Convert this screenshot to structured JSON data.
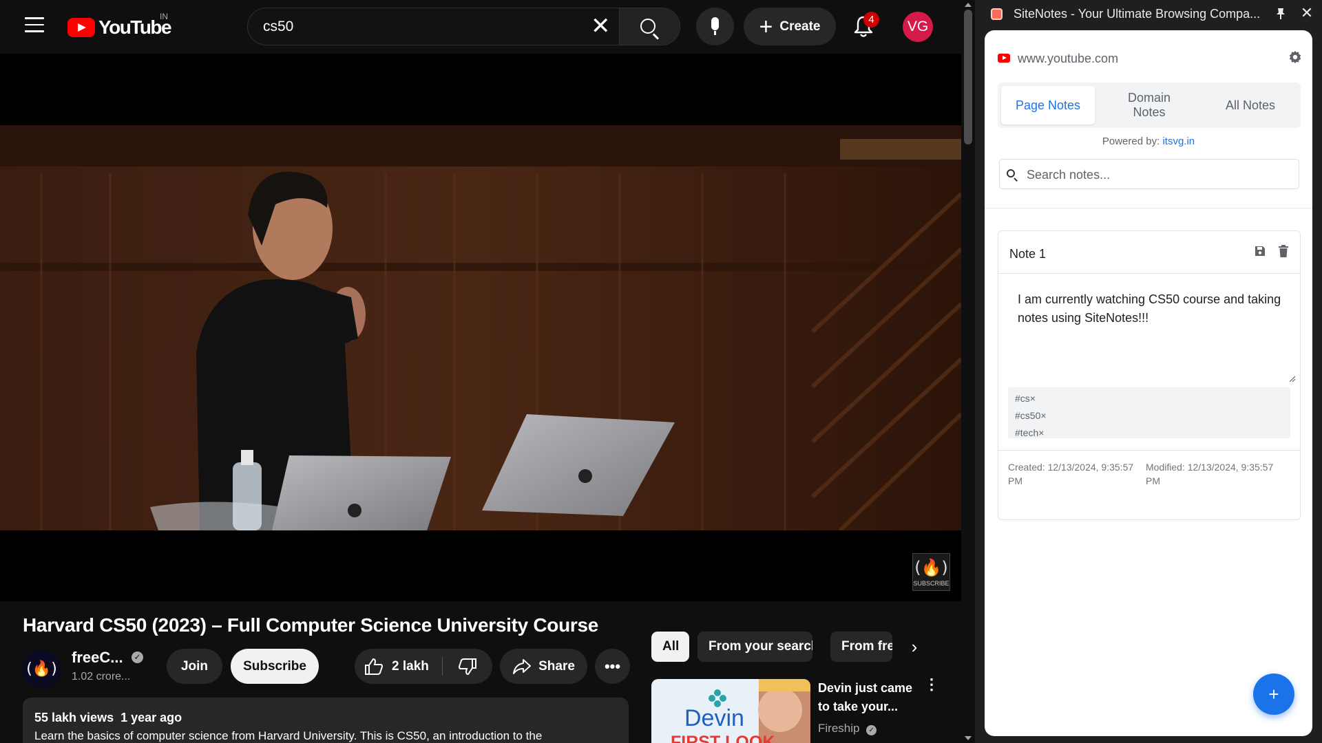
{
  "youtube": {
    "logo_text": "YouTube",
    "country_code": "IN",
    "search": {
      "value": "cs50"
    },
    "create_label": "Create",
    "notification_count": "4",
    "avatar_initials": "VG",
    "watermark_label": "SUBSCRIBE",
    "video": {
      "title": "Harvard CS50 (2023) – Full Computer Science University Course",
      "channel_name": "freeC...",
      "channel_subs": "1.02 crore...",
      "join_label": "Join",
      "subscribe_label": "Subscribe",
      "likes": "2 lakh",
      "share_label": "Share",
      "views": "55 lakh views",
      "age": "1 year ago",
      "description": "Learn the basics of computer science from Harvard University. This is CS50, an introduction to the"
    },
    "chips": [
      "All",
      "From your search",
      "From freeCodeCamp"
    ],
    "recommendation": {
      "title": "Devin just came to take your...",
      "channel": "Fireship",
      "thumb_text_1": "Devin",
      "thumb_text_2": "FIRST LOOK"
    }
  },
  "sidepanel": {
    "title": "SiteNotes - Your Ultimate Browsing Compa...",
    "domain": "www.youtube.com",
    "tabs": [
      {
        "label": "Page Notes",
        "active": true
      },
      {
        "label": "Domain Notes",
        "active": false
      },
      {
        "label": "All Notes",
        "active": false
      }
    ],
    "powered_by_label": "Powered by:",
    "powered_by_link": "itsvg.in",
    "search_placeholder": "Search notes...",
    "note": {
      "title": "Note 1",
      "content": "I am currently watching CS50 course and taking notes using SiteNotes!!!",
      "tags": [
        "#cs",
        "#cs50",
        "#tech"
      ],
      "created": "Created: 12/13/2024, 9:35:57 PM",
      "modified": "Modified: 12/13/2024, 9:35:57 PM"
    },
    "fab_label": "+"
  },
  "colors": {
    "youtube_red": "#ff0000",
    "accent_blue": "#1a73e8",
    "avatar_bg": "#d6194b"
  }
}
